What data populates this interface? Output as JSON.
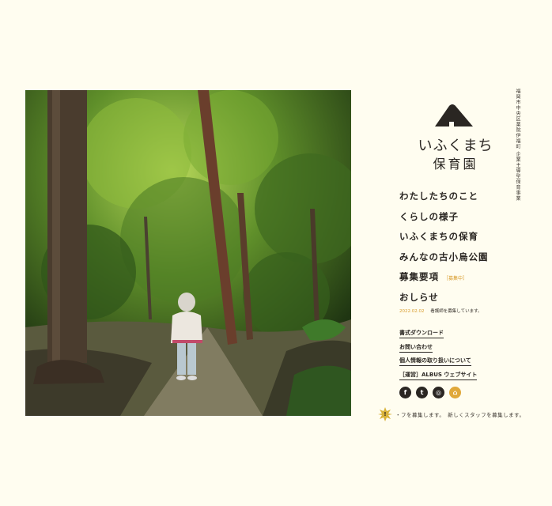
{
  "site": {
    "tagline_vertical": "福岡市中央区薬院伊福町 企業主導型保育事業",
    "logo_title": "いふくまち",
    "logo_sub": "保育園"
  },
  "main_nav": [
    {
      "label": "わたしたちのこと"
    },
    {
      "label": "くらしの様子"
    },
    {
      "label": "いふくまちの保育"
    },
    {
      "label": "みんなの古小烏公園"
    },
    {
      "label": "募集要項",
      "badge": "［募集中］"
    },
    {
      "label": "おしらせ"
    }
  ],
  "news": {
    "date": "2022.02.02",
    "text": "看護師を募集しています。"
  },
  "sub_nav": [
    {
      "label": "書式ダウンロード"
    },
    {
      "label": "お問い合わせ"
    },
    {
      "label": "個人情報の取り扱いについて"
    },
    {
      "label": "［運営］ALBUS ウェブサイト"
    }
  ],
  "social": [
    {
      "icon": "facebook-icon",
      "glyph": "f"
    },
    {
      "icon": "twitter-icon",
      "glyph": "t"
    },
    {
      "icon": "instagram-icon",
      "glyph": "◎"
    },
    {
      "icon": "shop-icon",
      "glyph": "⌂"
    }
  ],
  "ticker": {
    "badge": "!",
    "text": "・フを募集します。　新しくスタッフを募集します。"
  },
  "colors": {
    "background": "#fffdf0",
    "accent": "#d99c2b",
    "text": "#2a2622"
  }
}
